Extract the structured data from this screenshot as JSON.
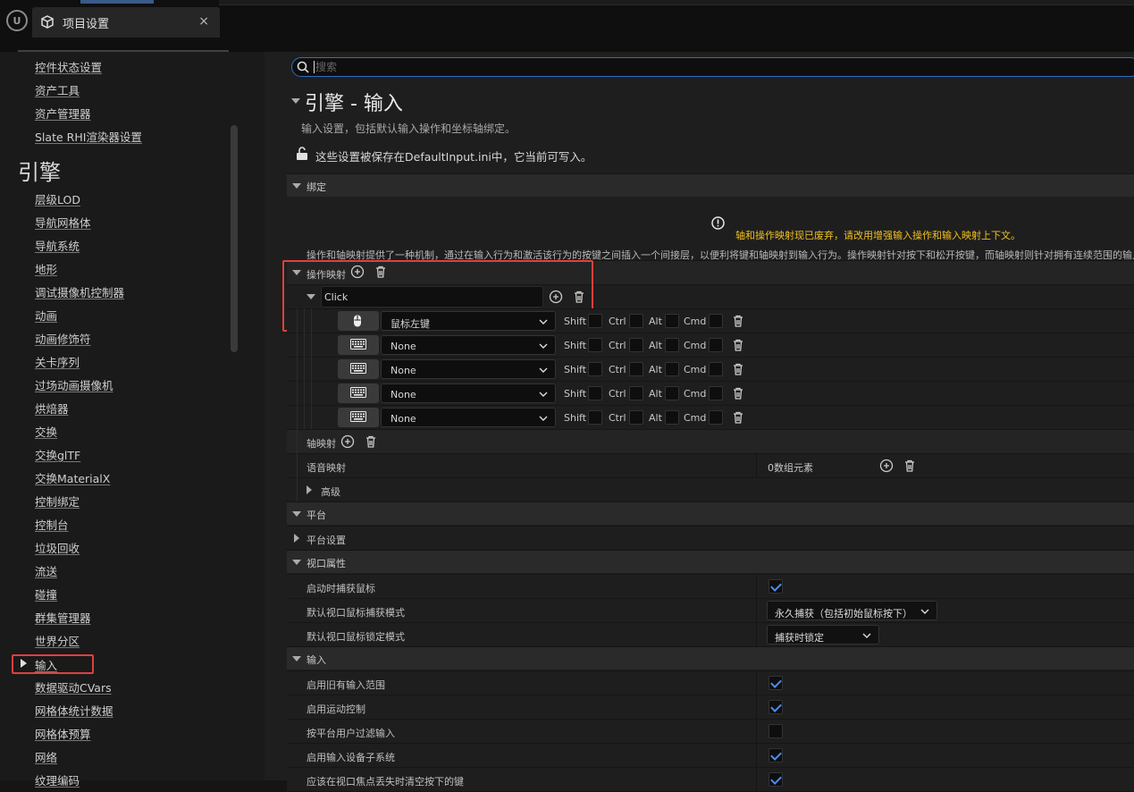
{
  "tab": {
    "title": "项目设置",
    "close": "×"
  },
  "logo": {
    "text": "U"
  },
  "sidebar": {
    "items_top": [
      "控件状态设置",
      "资产工具",
      "资产管理器",
      "Slate RHI渲染器设置"
    ],
    "section_heading": "引擎",
    "items": [
      "层级LOD",
      "导航网格体",
      "导航系统",
      "地形",
      "调试摄像机控制器",
      "动画",
      "动画修饰符",
      "关卡序列",
      "过场动画摄像机",
      "烘焙器",
      "交换",
      "交换glTF",
      "交换MaterialX",
      "控制绑定",
      "控制台",
      "垃圾回收",
      "流送",
      "碰撞",
      "群集管理器",
      "世界分区",
      "输入",
      "数据驱动CVars",
      "网格体统计数据",
      "网格体预算",
      "网络",
      "纹理编码"
    ],
    "selected": "输入"
  },
  "search": {
    "placeholder": "搜索",
    "value": ""
  },
  "page": {
    "title": "引擎 - 输入",
    "subtitle": "输入设置，包括默认输入操作和坐标轴绑定。",
    "save_notice": "这些设置被保存在DefaultInput.ini中，它当前可写入。"
  },
  "sections": {
    "bindings": "绑定",
    "platform": "平台",
    "viewport": "视口属性",
    "input": "输入"
  },
  "bindings": {
    "deprecation_warning": "轴和操作映射现已废弃，请改用增强输入操作和输入映射上下文。",
    "description": "操作和轴映射提供了一种机制，通过在输入行为和激活该行为的按键之间插入一个间接层，以便利将键和轴映射到输入行为。操作映射针对按下和松开按键，而轴映射则针对拥有连续范围的输入。",
    "action_mappings_label": "操作映射",
    "action_name": "Click",
    "keys": [
      {
        "device": "mouse-icon",
        "key": "鼠标左键",
        "shift": false,
        "ctrl": false,
        "alt": false,
        "cmd": false
      },
      {
        "device": "keyboard-icon",
        "key": "None",
        "shift": false,
        "ctrl": false,
        "alt": false,
        "cmd": false
      },
      {
        "device": "keyboard-icon",
        "key": "None",
        "shift": false,
        "ctrl": false,
        "alt": false,
        "cmd": false
      },
      {
        "device": "keyboard-icon",
        "key": "None",
        "shift": false,
        "ctrl": false,
        "alt": false,
        "cmd": false
      },
      {
        "device": "keyboard-icon",
        "key": "None",
        "shift": false,
        "ctrl": false,
        "alt": false,
        "cmd": false
      }
    ],
    "modifiers": {
      "shift": "Shift",
      "ctrl": "Ctrl",
      "alt": "Alt",
      "cmd": "Cmd"
    },
    "axis_mappings_label": "轴映射",
    "speech_mappings_label": "语音映射",
    "speech_mappings_value": "0数组元素",
    "advanced_label": "高级"
  },
  "platform": {
    "settings_label": "平台设置"
  },
  "viewport": {
    "capture_on_start_label": "启动时捕获鼠标",
    "capture_on_start": true,
    "capture_mode_label": "默认视口鼠标捕获模式",
    "capture_mode_value": "永久捕获（包括初始鼠标按下）",
    "lock_mode_label": "默认视口鼠标锁定模式",
    "lock_mode_value": "捕获时锁定"
  },
  "input": {
    "rows": [
      {
        "label": "启用旧有输入范围",
        "checked": true
      },
      {
        "label": "启用运动控制",
        "checked": true
      },
      {
        "label": "按平台用户过滤输入",
        "checked": false
      },
      {
        "label": "启用输入设备子系统",
        "checked": true
      },
      {
        "label": "应该在视口焦点丢失时清空按下的键",
        "checked": true
      }
    ]
  },
  "colors": {
    "accent": "#2f6ec8",
    "highlight": "#e04040",
    "warning": "#f0c020",
    "check": "#4a8cf0"
  }
}
